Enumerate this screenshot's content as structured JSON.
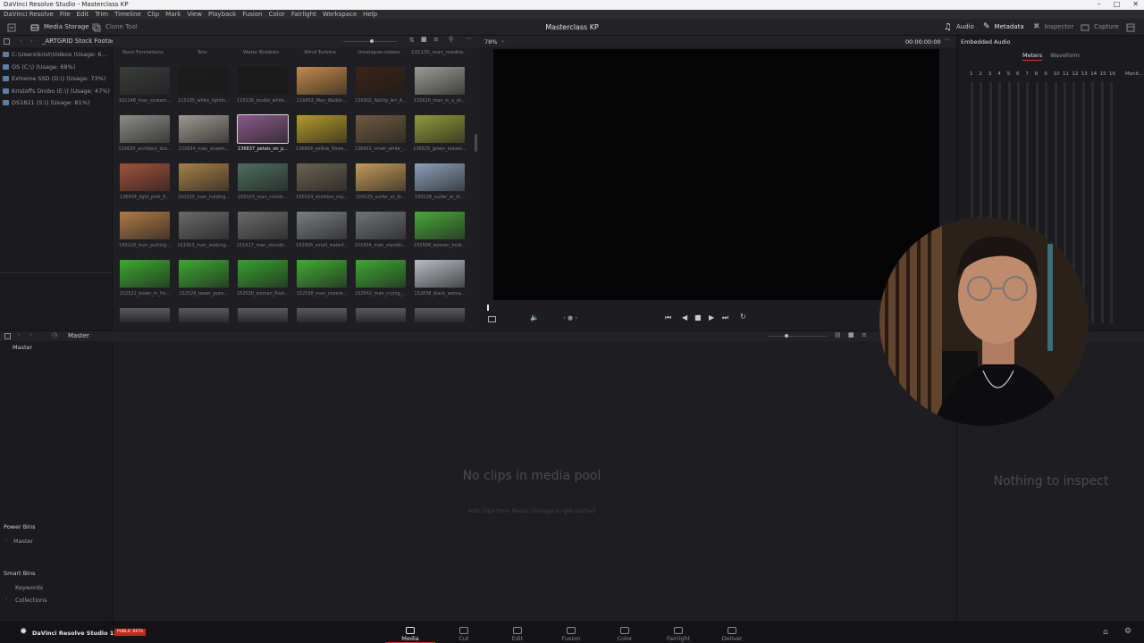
{
  "window": {
    "title": "DaVinci Resolve Studio - Masterclass KP"
  },
  "menu": [
    "DaVinci Resolve",
    "File",
    "Edit",
    "Trim",
    "Timeline",
    "Clip",
    "Mark",
    "View",
    "Playback",
    "Fusion",
    "Color",
    "Fairlight",
    "Workspace",
    "Help"
  ],
  "toolbar": {
    "media_storage": "Media Storage",
    "clone_tool": "Clone Tool",
    "project_title": "Masterclass KP",
    "audio": "Audio",
    "metadata": "Metadata",
    "inspector": "Inspector",
    "capture": "Capture"
  },
  "storage": {
    "path": "_ARTGRID Stock Footage",
    "drives": [
      "C:\\Users\\krist\\Videos (Usage: 6...",
      "OS (C:\\) (Usage: 68%)",
      "Extreme SSD (D:\\) (Usage: 73%)",
      "Kristoffs Drobo (E:\\) (Usage: 47%)",
      "DS1821 (S:\\) (Usage: 81%)"
    ]
  },
  "folders": [
    "Rock Formations",
    "Tets",
    "Water Bubbles",
    "Wind Turbine",
    "timelapse-videos",
    "101135_man_medita..."
  ],
  "clips": [
    "101148_man_scream...",
    "115135_white_lightin...",
    "115136_studio_white...",
    "116652_Man_Walkin...",
    "130302_Ability_Art_A...",
    "132616_man_in_a_sh...",
    "132620_architect_dra...",
    "132634_man_drawin...",
    "136837_petals_on_p...",
    "136869_yellow_flowe...",
    "136901_small_white_...",
    "136925_green_leaves...",
    "136934_light_pink_fl...",
    "150100_man_holding...",
    "150103_man_runnin...",
    "150114_shirtless_ma...",
    "150125_surfer_at_th...",
    "150128_surfer_at_th...",
    "150129_man_putting...",
    "151913_man_walking...",
    "151917_man_standin...",
    "151926_small_waterf...",
    "151934_man_standin...",
    "152508_woman_hold...",
    "152522_boxer_in_fro...",
    "152526_boxer_punc...",
    "152530_woman_float...",
    "152538_man_covere...",
    "152542_man_crying_...",
    "152838_black_woma..."
  ],
  "viewer": {
    "zoom": "78%",
    "timecode": "00:00:00:00",
    "panel_title": "Embedded Audio"
  },
  "meters": {
    "tabs": [
      "Meters",
      "Waveform"
    ],
    "channels": [
      "1",
      "2",
      "3",
      "4",
      "5",
      "6",
      "7",
      "8",
      "9",
      "10",
      "11",
      "12",
      "13",
      "14",
      "15",
      "16"
    ],
    "monitor": "Monit..."
  },
  "pool": {
    "header": "Master",
    "bin": "Master",
    "empty_title": "No clips in media pool",
    "empty_sub": "Add clips from Media Storage to get started",
    "inspect_empty": "Nothing to inspect"
  },
  "bins": {
    "power_bins": "Power Bins",
    "power_master": "Master",
    "smart_bins": "Smart Bins",
    "keywords": "Keywords",
    "collections": "Collections"
  },
  "bottom": {
    "brand": "DaVinci Resolve Studio 18.5",
    "badge": "PUBLIC BETA",
    "pages": [
      "Media",
      "Cut",
      "Edit",
      "Fusion",
      "Color",
      "Fairlight",
      "Deliver"
    ],
    "active_page": "Media"
  },
  "colors": {
    "accent_red": "#e0301e",
    "meter_active_tab": "#e0301e"
  }
}
